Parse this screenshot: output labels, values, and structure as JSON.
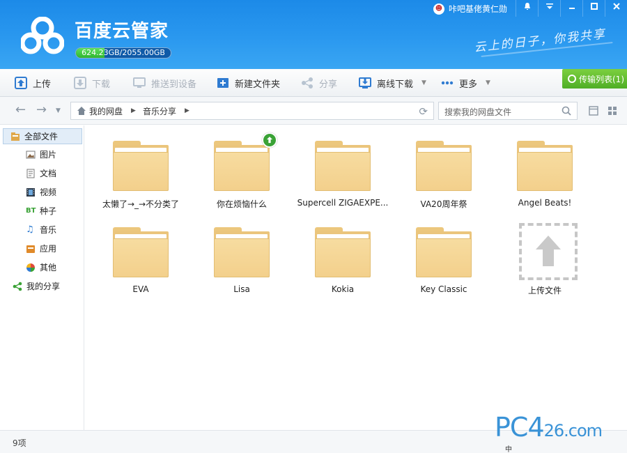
{
  "app": {
    "title": "百度云管家",
    "quota": "624.23GB/2055.00GB",
    "quota_fraction": 0.304,
    "slogan": "云上的日子，你我共享",
    "username": "咔吧基佬黄仁勋"
  },
  "window_controls": [
    "notify-icon",
    "dropdown-icon",
    "minimize-icon",
    "maximize-icon",
    "close-icon"
  ],
  "toolbar": {
    "upload": "上传",
    "download": "下载",
    "push": "推送到设备",
    "new_folder": "新建文件夹",
    "share": "分享",
    "offline": "离线下载",
    "more": "更多",
    "transfer_list": "传输列表(1)"
  },
  "breadcrumb": {
    "root": "我的网盘",
    "current": "音乐分享"
  },
  "search": {
    "placeholder": "搜索我的网盘文件"
  },
  "sidebar": {
    "items": [
      {
        "label": "全部文件",
        "icon": "all-files-icon"
      },
      {
        "label": "图片",
        "icon": "picture-icon"
      },
      {
        "label": "文档",
        "icon": "document-icon"
      },
      {
        "label": "视频",
        "icon": "video-icon"
      },
      {
        "label": "种子",
        "icon": "bt-icon"
      },
      {
        "label": "音乐",
        "icon": "music-icon"
      },
      {
        "label": "应用",
        "icon": "app-icon"
      },
      {
        "label": "其他",
        "icon": "other-icon"
      },
      {
        "label": "我的分享",
        "icon": "share-icon"
      }
    ]
  },
  "files": [
    {
      "name": "太懒了→_→不分类了"
    },
    {
      "name": "你在烦恼什么",
      "badge": "upload-badge"
    },
    {
      "name": "Supercell ZIGAEXPE..."
    },
    {
      "name": "VA20周年祭"
    },
    {
      "name": "Angel Beats!"
    },
    {
      "name": "EVA"
    },
    {
      "name": "Lisa"
    },
    {
      "name": "Kokia"
    },
    {
      "name": "Key Classic"
    }
  ],
  "upload_file": "上传文件",
  "status": {
    "count": "9项"
  },
  "watermark": {
    "brand": "PC4",
    "suffix": "26.com"
  },
  "tray": {
    "ime": "中"
  },
  "colors": {
    "title_blue": "#2a98ef",
    "transfer_green": "#4fae26",
    "folder_yellow": "#f3d08c",
    "quota_green": "#2fb52f"
  }
}
